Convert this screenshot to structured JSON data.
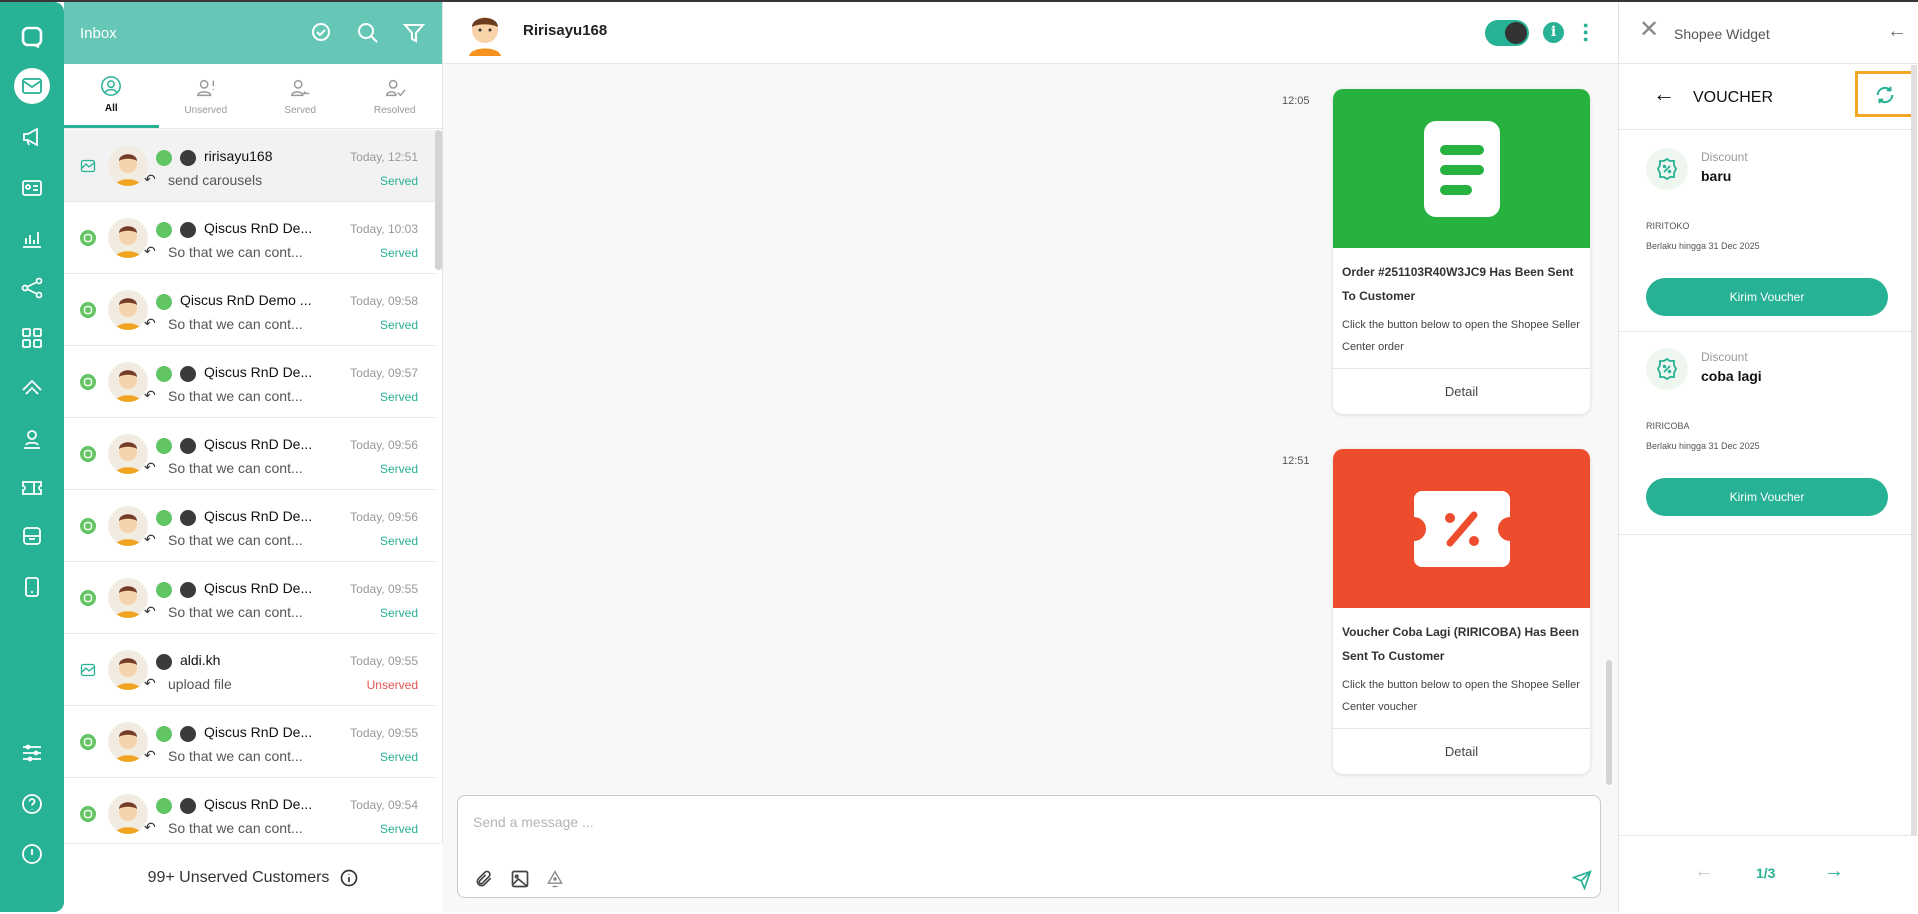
{
  "inbox": {
    "title": "Inbox",
    "tabs": [
      {
        "label": "All"
      },
      {
        "label": "Unserved"
      },
      {
        "label": "Served"
      },
      {
        "label": "Resolved"
      }
    ],
    "rows": [
      {
        "name": "ririsayu168",
        "message": "send carousels",
        "time": "Today, 12:51",
        "status": "Served",
        "channel": "shopee"
      },
      {
        "name": "Qiscus RnD De...",
        "message": "So that we can cont...",
        "time": "Today, 10:03",
        "status": "Served",
        "channel": "qiscus"
      },
      {
        "name": "Qiscus RnD Demo ...",
        "message": "So that we can cont...",
        "time": "Today, 09:58",
        "status": "Served",
        "channel": "qiscus"
      },
      {
        "name": "Qiscus RnD De...",
        "message": "So that we can cont...",
        "time": "Today, 09:57",
        "status": "Served",
        "channel": "qiscus"
      },
      {
        "name": "Qiscus RnD De...",
        "message": "So that we can cont...",
        "time": "Today, 09:56",
        "status": "Served",
        "channel": "qiscus"
      },
      {
        "name": "Qiscus RnD De...",
        "message": "So that we can cont...",
        "time": "Today, 09:56",
        "status": "Served",
        "channel": "qiscus"
      },
      {
        "name": "Qiscus RnD De...",
        "message": "So that we can cont...",
        "time": "Today, 09:55",
        "status": "Served",
        "channel": "qiscus"
      },
      {
        "name": "aldi.kh",
        "message": "upload file",
        "time": "Today, 09:55",
        "status": "Unserved",
        "channel": "shopee"
      },
      {
        "name": "Qiscus RnD De...",
        "message": "So that we can cont...",
        "time": "Today, 09:55",
        "status": "Served",
        "channel": "qiscus"
      },
      {
        "name": "Qiscus RnD De...",
        "message": "So that we can cont...",
        "time": "Today, 09:54",
        "status": "Served",
        "channel": "qiscus"
      }
    ],
    "unserved_label": "99+ Unserved Customers"
  },
  "chat": {
    "contact": "Ririsayu168",
    "composer_placeholder": "Send a message ...",
    "messages": [
      {
        "time": "12:05",
        "title": "Order #251103R40W3JC9 Has Been Sent To Customer",
        "desc": "Click the button below to open the Shopee Seller Center order",
        "button": "Detail",
        "color": "#27b23f"
      },
      {
        "time": "12:51",
        "title": "Voucher Coba Lagi (RIRICOBA) Has Been Sent To Customer",
        "desc": "Click the button below to open the Shopee Seller Center voucher",
        "button": "Detail",
        "color": "#ee4d2d"
      }
    ]
  },
  "widget": {
    "title": "Shopee Widget",
    "section": "VOUCHER",
    "vouchers": [
      {
        "type": "Discount",
        "name": "baru",
        "code": "RIRITOKO",
        "valid": "Berlaku hingga 31 Dec 2025",
        "button": "Kirim Voucher"
      },
      {
        "type": "Discount",
        "name": "coba lagi",
        "code": "RIRICOBA",
        "valid": "Berlaku hingga 31 Dec 2025",
        "button": "Kirim Voucher"
      }
    ],
    "pagination": "1/3"
  },
  "colors": {
    "accent": "#27b195",
    "highlight": "#f5a623"
  }
}
